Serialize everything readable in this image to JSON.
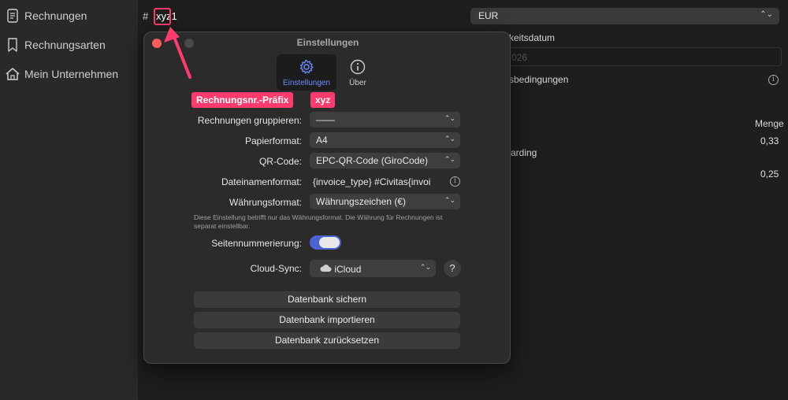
{
  "sidebar": {
    "items": [
      {
        "label": "Rechnungen",
        "icon": "document-icon"
      },
      {
        "label": "Rechnungsarten",
        "icon": "bookmark-icon"
      },
      {
        "label": "Mein Unternehmen",
        "icon": "house-icon"
      }
    ]
  },
  "invoice": {
    "hash_label": "#",
    "number_value": "xyz1",
    "currency": "EUR",
    "date_label": "keitsdatum",
    "date_placeholder": "026",
    "terms_label": "sbedingungen",
    "quantity_header": "Menge",
    "row1_quantity": "0,33",
    "row2_text": "arding",
    "row3_quantity": "0,25"
  },
  "settings_window": {
    "title": "Einstellungen",
    "tabs": [
      {
        "label": "Einstellungen",
        "icon": "gear-icon",
        "active": true
      },
      {
        "label": "Über",
        "icon": "info-icon",
        "active": false
      }
    ],
    "annotations": {
      "prefix_label": "Rechnungsnr.-Präfix",
      "prefix_value": "xyz"
    },
    "rows": {
      "group_label": "Rechnungen gruppieren:",
      "group_value": "——",
      "paper_label": "Papierformat:",
      "paper_value": "A4",
      "qr_label": "QR-Code:",
      "qr_value": "EPC-QR-Code (GiroCode)",
      "filename_label": "Dateinamenformat:",
      "filename_value": "{invoice_type} #Civitas{invoi",
      "currency_label": "Währungsformat:",
      "currency_value": "Währungszeichen (€)",
      "currency_note": "Diese Einstellung betrifft nur das Währungsformat. Die Währung für Rechnungen ist separat einstellbar.",
      "pagination_label": "Seitennummerierung:",
      "pagination_on": true,
      "cloud_label": "Cloud-Sync:",
      "cloud_value": "iCloud",
      "help_label": "?"
    },
    "buttons": {
      "backup": "Datenbank sichern",
      "import": "Datenbank importieren",
      "reset": "Datenbank zurücksetzen"
    }
  },
  "colors": {
    "accent_highlight": "#ff3b6e",
    "toggle_on": "#4a63cf",
    "tab_active": "#6e8cff",
    "close_button": "#ff5f57"
  }
}
